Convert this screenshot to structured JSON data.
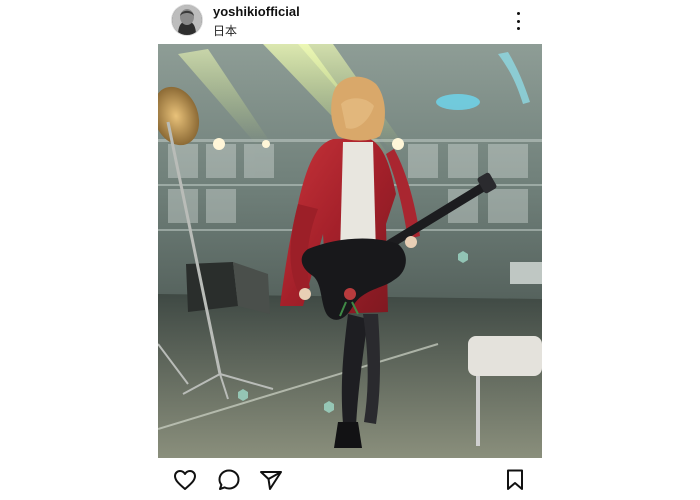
{
  "post": {
    "username": "yoshikiofficial",
    "location": "日本"
  },
  "icons": {
    "avatar": "profile-avatar",
    "more": "more-options-icon",
    "like": "heart-icon",
    "comment": "comment-bubble-icon",
    "share": "paper-plane-icon",
    "save": "bookmark-icon"
  },
  "colors": {
    "text": "#111111",
    "background": "#ffffff",
    "jacket": "#b0232c"
  }
}
